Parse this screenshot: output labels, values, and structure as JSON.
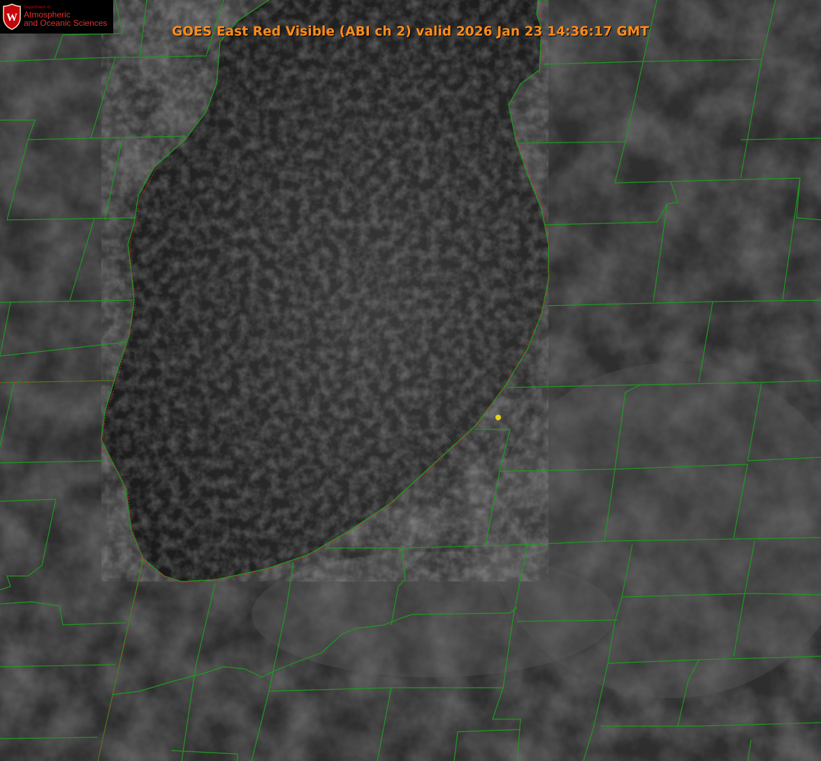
{
  "title": "GOES East Red Visible (ABI ch 2) valid 2026 Jan 23 14:36:17 GMT",
  "logo": {
    "department": "Department of",
    "line1": "Atmospheric",
    "line2": "and Oceanic Sciences",
    "seal_letter": "W",
    "color": "#c5050c"
  },
  "colors": {
    "title": "#ff8c1a",
    "county_lines": "#1f9a1f",
    "shoreline": "#d02020",
    "marker": "#e6d21a",
    "lake": "#2b2b2b",
    "land": "#303030"
  },
  "icons": {
    "marker": "location-dot-icon",
    "seal": "university-seal-icon"
  }
}
